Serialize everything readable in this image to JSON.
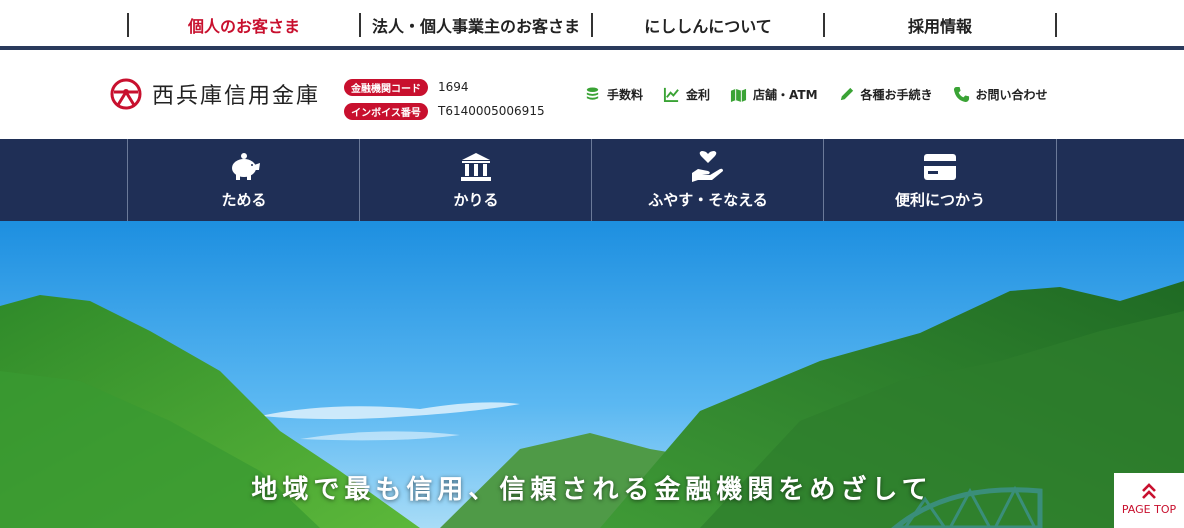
{
  "top_tabs": [
    {
      "label": "個人のお客さま",
      "active": true
    },
    {
      "label": "法人・個人事業主のお客さま",
      "active": false
    },
    {
      "label": "にししんについて",
      "active": false
    },
    {
      "label": "採用情報",
      "active": false
    }
  ],
  "header": {
    "logo_text": "西兵庫信用金庫",
    "codes": [
      {
        "badge": "金融機関コード",
        "value": "1694"
      },
      {
        "badge": "インボイス番号",
        "value": "T6140005006915"
      }
    ],
    "utility_links": [
      {
        "label": "手数料",
        "icon": "coins-icon"
      },
      {
        "label": "金利",
        "icon": "line-chart-icon"
      },
      {
        "label": "店舗・ATM",
        "icon": "map-icon"
      },
      {
        "label": "各種お手続き",
        "icon": "pencil-icon"
      },
      {
        "label": "お問い合わせ",
        "icon": "phone-icon"
      }
    ]
  },
  "main_nav": [
    {
      "label": "ためる",
      "icon": "piggy-bank-icon"
    },
    {
      "label": "かりる",
      "icon": "bank-building-icon"
    },
    {
      "label": "ふやす・そなえる",
      "icon": "hand-heart-icon"
    },
    {
      "label": "便利につかう",
      "icon": "credit-card-icon"
    }
  ],
  "hero": {
    "copy": "地域で最も信用、信頼される金融機関をめざして"
  },
  "page_top": {
    "label": "PAGE TOP"
  },
  "colors": {
    "accent_red": "#c8102e",
    "navy": "#1f2f56",
    "green_icon": "#3aa335"
  }
}
